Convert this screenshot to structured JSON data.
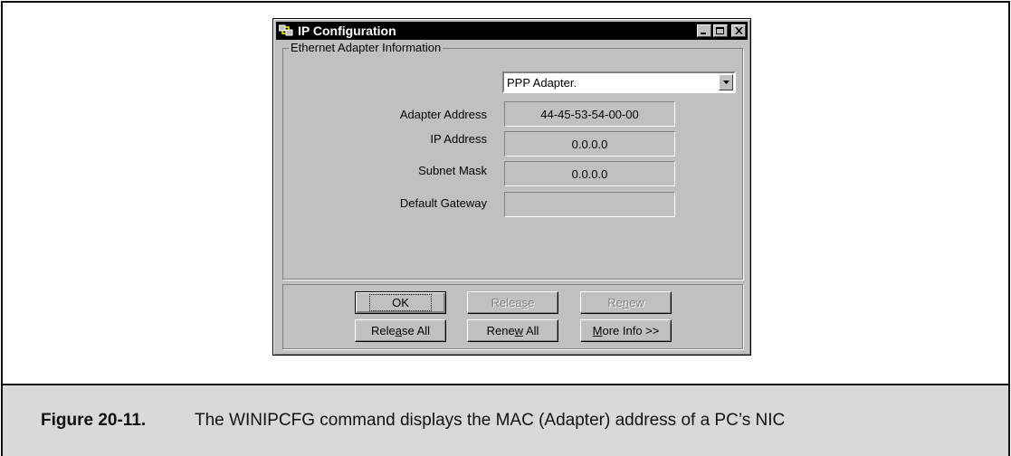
{
  "window": {
    "title": "IP Configuration",
    "controls": {
      "minimize": "_",
      "maximize": "□",
      "close": "×"
    }
  },
  "group": {
    "label": "Ethernet  Adapter Information",
    "adapter_select": "PPP Adapter.",
    "fields": [
      {
        "label": "Adapter Address",
        "value": "44-45-53-54-00-00"
      },
      {
        "label": "IP Address",
        "value": "0.0.0.0"
      },
      {
        "label": "Subnet Mask",
        "value": "0.0.0.0"
      },
      {
        "label": "Default Gateway",
        "value": ""
      }
    ]
  },
  "buttons": {
    "ok": "OK",
    "release": {
      "pre": "Relea",
      "u": "s",
      "post": "e"
    },
    "renew": {
      "pre": "Re",
      "u": "n",
      "post": "ew"
    },
    "release_all": {
      "pre": "Rele",
      "u": "a",
      "post": "se All"
    },
    "renew_all": {
      "pre": "Rene",
      "u": "w",
      "post": " All"
    },
    "more_info": {
      "pre": "",
      "u": "M",
      "post": "ore Info >>"
    }
  },
  "caption": {
    "label": "Figure 20-11.",
    "text": "The WINIPCFG command displays the MAC (Adapter) address of a PC’s NIC"
  },
  "colors": {
    "window_bg": "#c0c0c0",
    "titlebar": "#000000",
    "caption_bg": "#d9d9d9"
  }
}
